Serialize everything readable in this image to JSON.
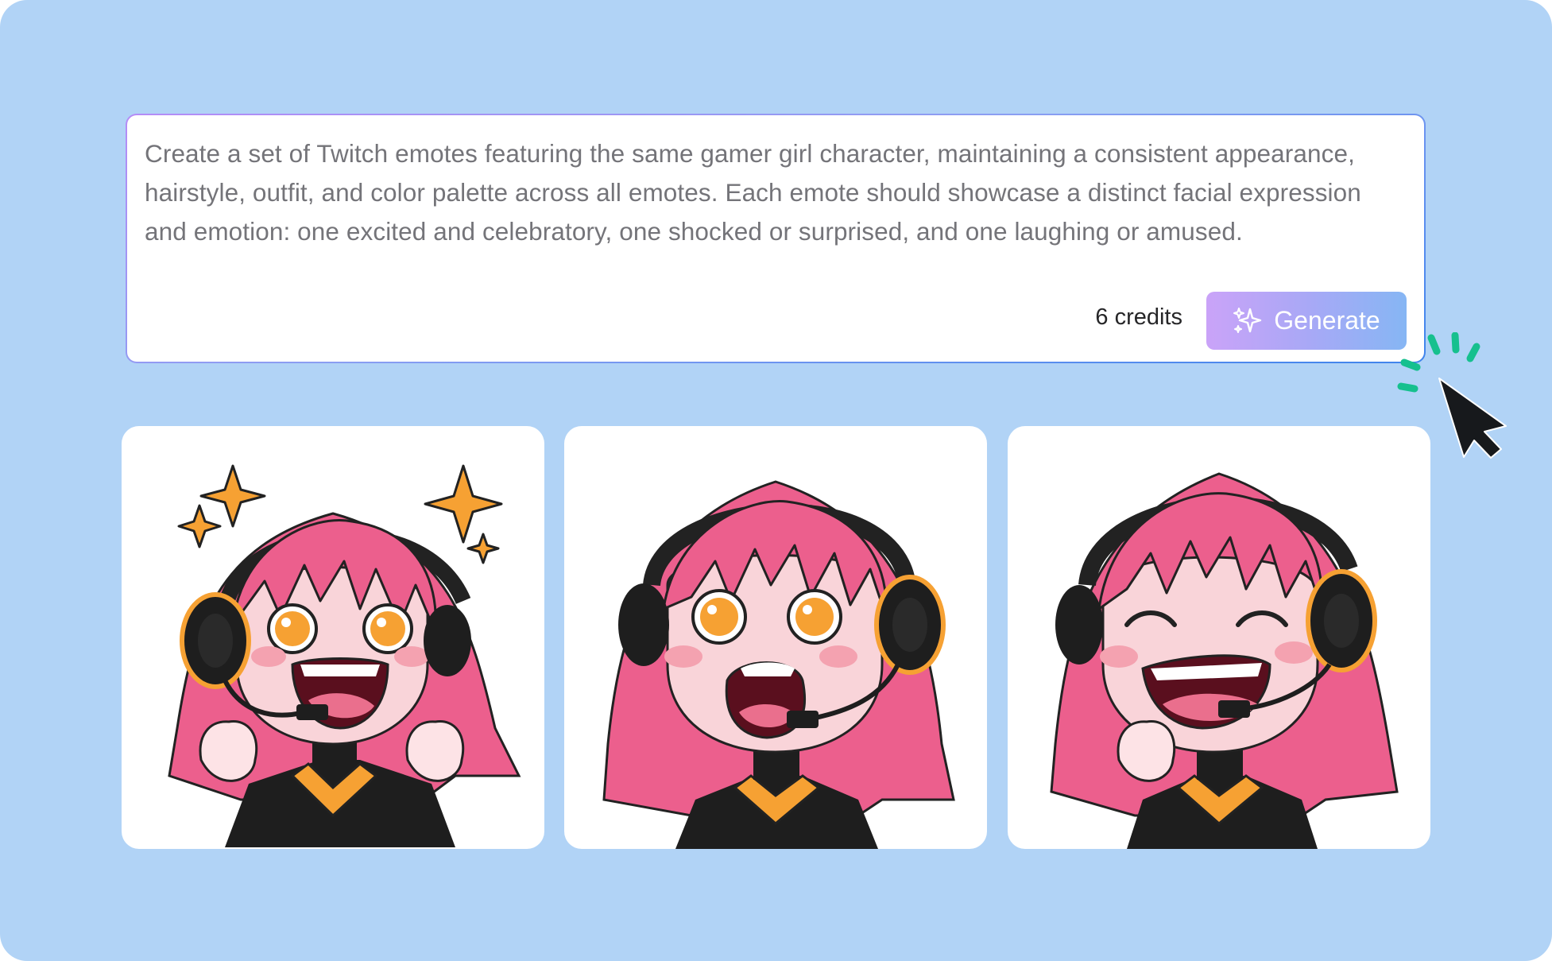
{
  "prompt": {
    "text": "Create a set of Twitch emotes featuring the same gamer girl character, maintaining a consistent appearance, hairstyle, outfit, and color palette across all emotes. Each emote should showcase a distinct facial expression and emotion: one excited and celebratory, one shocked or surprised, and one laughing or amused.",
    "credits": "6 credits",
    "generate_label": "Generate",
    "generate_icon": "sparkles-icon"
  },
  "results": [
    {
      "name": "emote-excited",
      "expression": "excited"
    },
    {
      "name": "emote-shocked",
      "expression": "shocked"
    },
    {
      "name": "emote-laughing",
      "expression": "laughing"
    }
  ],
  "colors": {
    "background": "#b1d3f6",
    "hair": "#ec5f8d",
    "headset_accent": "#f5a02e",
    "generate_gradient_start": "#caa3f8",
    "generate_gradient_end": "#86b6f4",
    "click_burst": "#16c08e"
  }
}
